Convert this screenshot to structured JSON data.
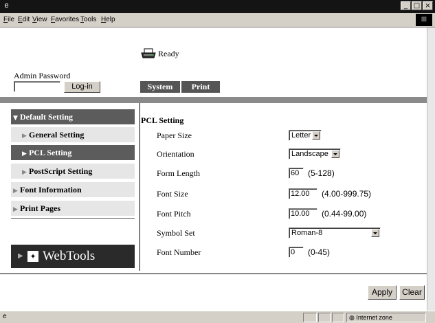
{
  "menu": [
    "File",
    "Edit",
    "View",
    "Favorites",
    "Tools",
    "Help"
  ],
  "window_buttons": {
    "minimize": "_",
    "maximize": "□",
    "close": "×"
  },
  "printer_status": "Ready",
  "admin": {
    "label": "Admin Password",
    "password_value": "",
    "login_label": "Log-in"
  },
  "tabs": [
    {
      "label": "System"
    },
    {
      "label": "Print"
    }
  ],
  "nav": {
    "default_setting": "Default Setting",
    "general_setting": "General Setting",
    "pcl_setting": "PCL Setting",
    "postscript_setting": "PostScript Setting",
    "font_information": "Font Information",
    "print_pages": "Print Pages"
  },
  "webtools_label": "WebTools",
  "section_title": "PCL Setting",
  "fields": {
    "paper_size": {
      "label": "Paper Size",
      "value": "Letter"
    },
    "orientation": {
      "label": "Orientation",
      "value": "Landscape"
    },
    "form_length": {
      "label": "Form Length",
      "value": "60",
      "range": "(5-128)"
    },
    "font_size": {
      "label": "Font Size",
      "value": "12.00",
      "range": "(4.00-999.75)"
    },
    "font_pitch": {
      "label": "Font Pitch",
      "value": "10.00",
      "range": "(0.44-99.00)"
    },
    "symbol_set": {
      "label": "Symbol Set",
      "value": "Roman-8"
    },
    "font_number": {
      "label": "Font Number",
      "value": "0",
      "range": "(0-45)"
    }
  },
  "buttons": {
    "apply": "Apply",
    "clear": "Clear"
  },
  "status_bar": {
    "zone": "Internet zone"
  },
  "colors": {
    "titlebar": "#141414",
    "nav_dark": "#5c5c5c",
    "nav_light": "#e6e6e6",
    "tab_bg": "#555555",
    "webtools_bg": "#2a2a2a"
  }
}
